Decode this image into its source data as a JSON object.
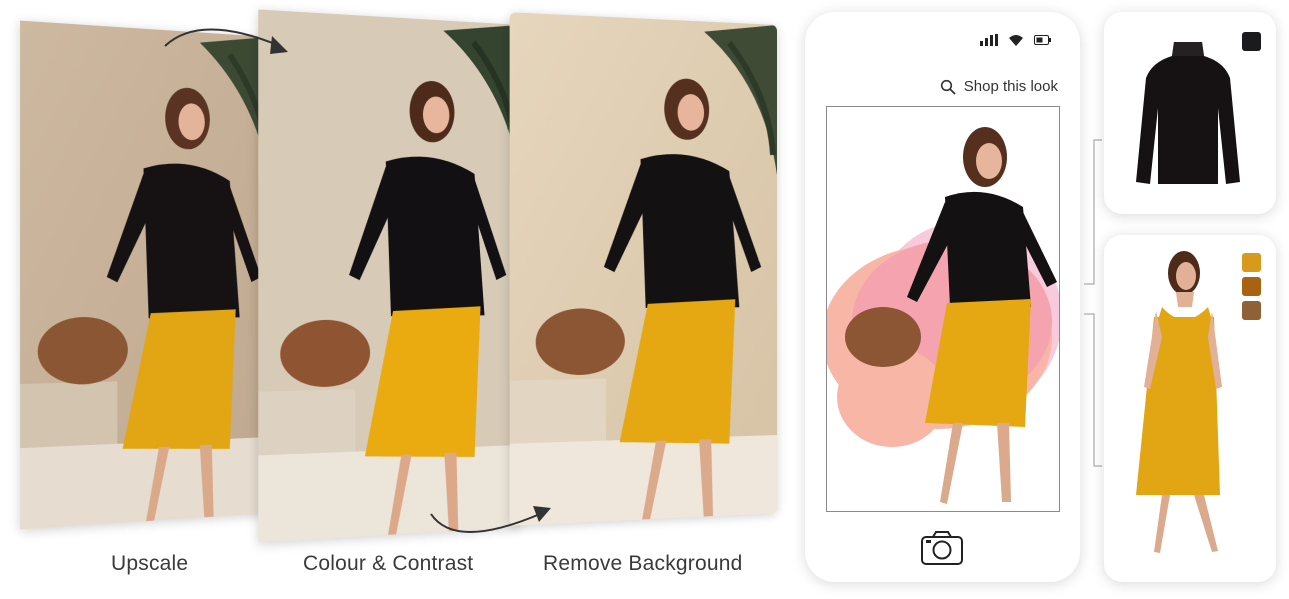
{
  "steps": [
    {
      "label": "Upscale"
    },
    {
      "label": "Colour & Contrast"
    },
    {
      "label": "Remove Background"
    }
  ],
  "phone": {
    "status_icons": [
      "signal-icon",
      "wifi-icon",
      "battery-icon"
    ],
    "shop_label": "Shop this look",
    "search_icon": "search-icon",
    "camera_icon": "camera-icon"
  },
  "products": {
    "sweater": {
      "swatches": [
        "#1b1a1c"
      ]
    },
    "dress": {
      "swatches": [
        "#d89a1c",
        "#a96112",
        "#8f6137"
      ]
    }
  },
  "colors": {
    "wall_warm": "#c9b59d",
    "wall_light": "#ddd1bf",
    "sweater": "#161214",
    "skirt": "#e2a514",
    "bag": "#8a5634",
    "blob_pink": "#f6a7b3",
    "blob_light_pink": "#f6cbd9",
    "blob_peach": "#f8b6a6"
  }
}
